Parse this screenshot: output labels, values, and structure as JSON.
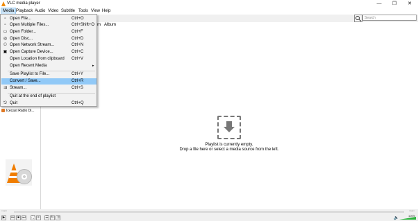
{
  "window": {
    "title": "VLC media player",
    "controls": {
      "minimize": "—",
      "maximize": "❐",
      "close": "✕"
    }
  },
  "menubar": {
    "items": [
      {
        "label": "Media"
      },
      {
        "label": "Playback"
      },
      {
        "label": "Audio"
      },
      {
        "label": "Video"
      },
      {
        "label": "Subtitle"
      },
      {
        "label": "Tools"
      },
      {
        "label": "View"
      },
      {
        "label": "Help"
      }
    ]
  },
  "media_menu": {
    "items": [
      {
        "label": "Open File...",
        "shortcut": "Ctrl+O",
        "icon": "file-icon"
      },
      {
        "label": "Open Multiple Files...",
        "shortcut": "Ctrl+Shift+O",
        "icon": "files-icon"
      },
      {
        "label": "Open Folder...",
        "shortcut": "Ctrl+F",
        "icon": "folder-icon"
      },
      {
        "label": "Open Disc...",
        "shortcut": "Ctrl+D",
        "icon": "disc-icon"
      },
      {
        "label": "Open Network Stream...",
        "shortcut": "Ctrl+N",
        "icon": "network-icon"
      },
      {
        "label": "Open Capture Device...",
        "shortcut": "Ctrl+C",
        "icon": "capture-icon"
      },
      {
        "label": "Open Location from clipboard",
        "shortcut": "Ctrl+V",
        "icon": ""
      },
      {
        "label": "Open Recent Media",
        "shortcut": "",
        "icon": "",
        "submenu": "▸"
      },
      {
        "label": "Save Playlist to File...",
        "shortcut": "Ctrl+Y",
        "icon": ""
      },
      {
        "label": "Convert / Save...",
        "shortcut": "Ctrl+R",
        "icon": ""
      },
      {
        "label": "Stream...",
        "shortcut": "Ctrl+S",
        "icon": "stream-icon"
      },
      {
        "label": "Quit at the end of playlist",
        "shortcut": "",
        "icon": ""
      },
      {
        "label": "Quit",
        "shortcut": "Ctrl+Q",
        "icon": "quit-icon"
      }
    ],
    "highlighted_label": "Convert / Save..."
  },
  "search": {
    "placeholder": "Search"
  },
  "playlist": {
    "columns": [
      "m",
      "Album"
    ],
    "empty_message": "Playlist is currently empty.",
    "drop_hint": "Drop a file here or select a media source from the left."
  },
  "sidebar": {
    "items": [
      "Icecast Radio Di..."
    ]
  },
  "player": {
    "elapsed": "--:--",
    "total": "--:--",
    "volume_percent": "100%"
  },
  "colors": {
    "accent_menu_active": "#cce4f7",
    "menu_highlight": "#91c9f7",
    "vlc_orange": "#f07d00",
    "volume_green": "#29b33a"
  }
}
